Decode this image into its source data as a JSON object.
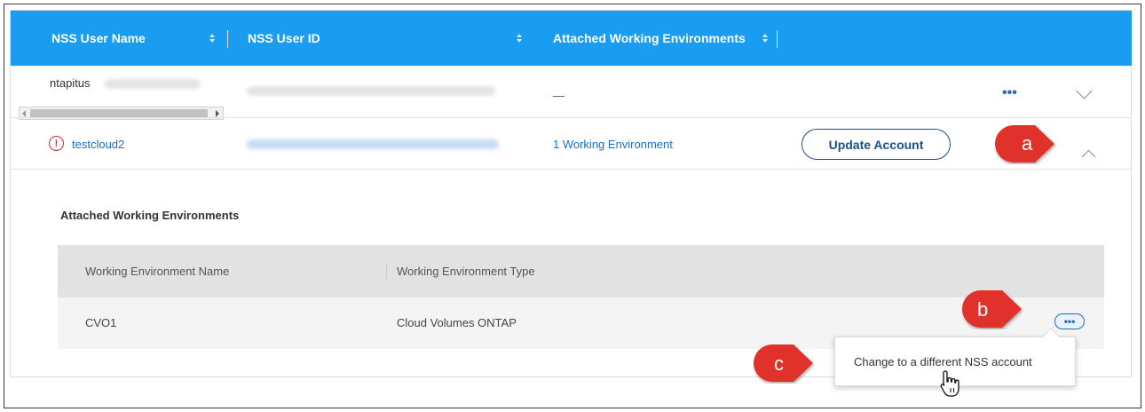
{
  "table": {
    "columns": [
      {
        "label": "NSS User Name"
      },
      {
        "label": "NSS User ID"
      },
      {
        "label": "Attached Working Environments"
      }
    ],
    "rows": [
      {
        "user_name": "ntapitus",
        "user_id": "",
        "environments": "—",
        "actions": "•••"
      },
      {
        "user_name": "testcloud2",
        "user_id": "",
        "environments": "1 Working Environment",
        "button": "Update Account"
      }
    ]
  },
  "details": {
    "title": "Attached Working Environments",
    "columns": [
      "Working Environment Name",
      "Working Environment Type"
    ],
    "rows": [
      {
        "name": "CVO1",
        "type": "Cloud Volumes ONTAP"
      }
    ],
    "menu_button": "•••"
  },
  "popover": {
    "item": "Change to a different NSS account"
  },
  "callouts": [
    "a",
    "b",
    "c"
  ],
  "icons": {
    "warning": "exclamation-circle-icon",
    "expand": "chevron-down-icon",
    "collapse": "chevron-up-icon",
    "cursor": "hand-pointer-icon"
  },
  "colors": {
    "header": "#1a9cf0",
    "link": "#1b6ec2",
    "warning": "#d42d2d",
    "callout": "#e0302a"
  }
}
